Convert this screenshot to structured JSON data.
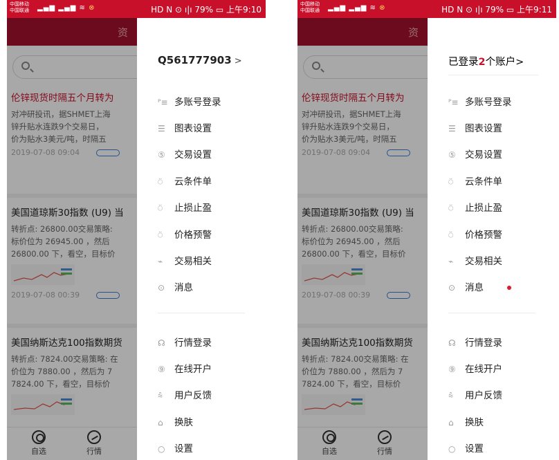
{
  "phones": [
    {
      "status": {
        "carrier_line1": "中国移动",
        "carrier_line2": "中国联通",
        "right_text": "HD  N  ⊙  ı|ı 79%  ▭  上午9:10"
      },
      "drawer": {
        "account_label": "Q561777903",
        "account_prefix": "",
        "account_count": "",
        "account_suffix": "",
        "account_chevron": ">",
        "items": [
          {
            "label": "多账号登录",
            "icon": "multi-account-icon"
          },
          {
            "label": "图表设置",
            "icon": "chart-settings-icon"
          },
          {
            "label": "交易设置",
            "icon": "trade-settings-icon"
          },
          {
            "label": "云条件单",
            "icon": "cloud-order-icon"
          },
          {
            "label": "止损止盈",
            "icon": "stop-loss-icon"
          },
          {
            "label": "价格预警",
            "icon": "price-alert-icon"
          },
          {
            "label": "交易相关",
            "icon": "trade-link-icon"
          },
          {
            "label": "消息",
            "icon": "message-icon",
            "badge": false
          }
        ],
        "items2": [
          {
            "label": "行情登录",
            "icon": "quote-login-icon"
          },
          {
            "label": "在线开户",
            "icon": "open-account-icon"
          },
          {
            "label": "用户反馈",
            "icon": "feedback-icon"
          },
          {
            "label": "换肤",
            "icon": "skin-icon"
          },
          {
            "label": "设置",
            "icon": "settings-icon"
          }
        ]
      }
    },
    {
      "status": {
        "carrier_line1": "中国移动",
        "carrier_line2": "中国联通",
        "right_text": "HD  N  ⊙  ı|ı 79%  ▭  上午9:11"
      },
      "drawer": {
        "account_label": "",
        "account_prefix": "已登录",
        "account_count": "2",
        "account_suffix": "个账户>",
        "account_chevron": "",
        "items": [
          {
            "label": "多账号登录",
            "icon": "multi-account-icon"
          },
          {
            "label": "图表设置",
            "icon": "chart-settings-icon"
          },
          {
            "label": "交易设置",
            "icon": "trade-settings-icon"
          },
          {
            "label": "云条件单",
            "icon": "cloud-order-icon"
          },
          {
            "label": "止损止盈",
            "icon": "stop-loss-icon"
          },
          {
            "label": "价格预警",
            "icon": "price-alert-icon"
          },
          {
            "label": "交易相关",
            "icon": "trade-link-icon"
          },
          {
            "label": "消息",
            "icon": "message-icon",
            "badge": true
          }
        ],
        "items2": [
          {
            "label": "行情登录",
            "icon": "quote-login-icon"
          },
          {
            "label": "在线开户",
            "icon": "open-account-icon"
          },
          {
            "label": "用户反馈",
            "icon": "feedback-icon"
          },
          {
            "label": "换肤",
            "icon": "skin-icon"
          },
          {
            "label": "设置",
            "icon": "settings-icon"
          }
        ]
      }
    }
  ],
  "background": {
    "header_char": "资",
    "articles": [
      {
        "title": "伦锌现货时隔五个月转为",
        "red": true,
        "body": "对冲研投讯，据SHMET上海\n锌升贴水连跌9个交易日，\n价为贴水3美元/吨，时隔五",
        "date": "2019-07-08  09:04"
      },
      {
        "title": "美国道琼斯30指数 (U9) 当",
        "red": false,
        "body": "转折点: 26800.00交易策略:\n标价位为 26945.00 ，然后\n26800.00 下，看空，目标价",
        "date": "2019-07-08  00:39"
      },
      {
        "title": "美国纳斯达克100指数期货",
        "red": false,
        "body": "转折点: 7824.00交易策略: 在\n价位为 7880.00 ，然后为 7\n7824.00 下，看空，目标价",
        "date": ""
      }
    ],
    "tabs": [
      {
        "label": "自选",
        "icon": "watchlist-icon"
      },
      {
        "label": "行情",
        "icon": "market-icon"
      }
    ]
  },
  "colors": {
    "brand_red": "#c9102b",
    "badge_red": "#e0192b"
  }
}
